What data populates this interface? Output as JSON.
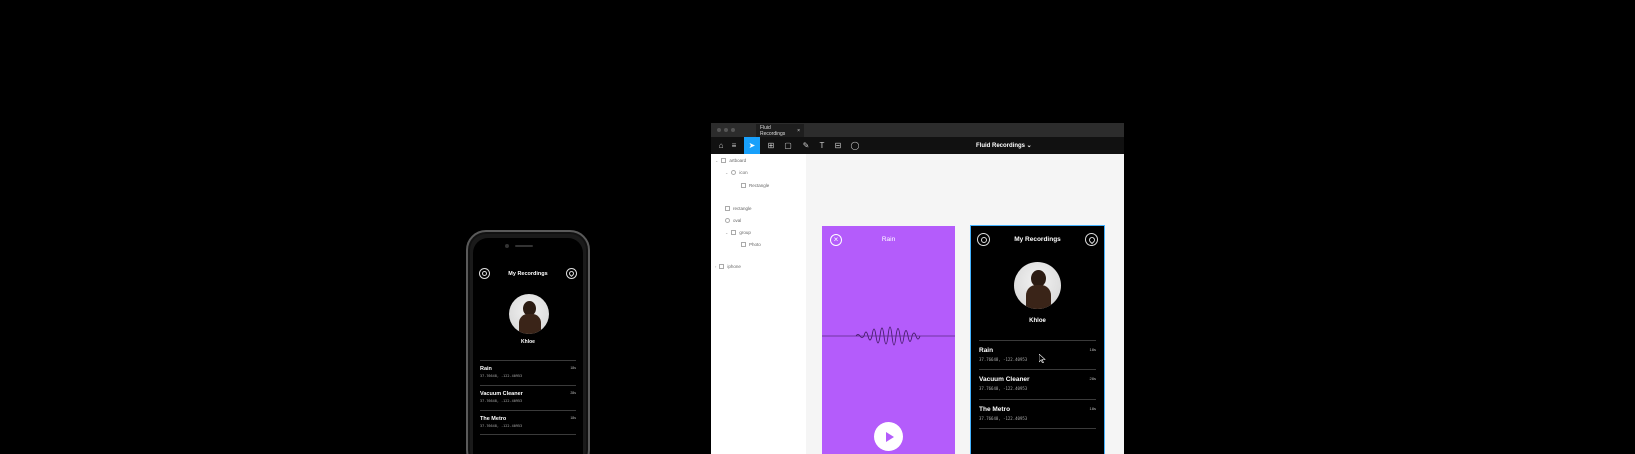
{
  "phone_app": {
    "title": "My Recordings",
    "user_name": "Khloe",
    "recordings": [
      {
        "title": "Rain",
        "duration": "18s",
        "coords": "37.76648, -122.40953"
      },
      {
        "title": "Vacuum Cleaner",
        "duration": "28s",
        "coords": "37.76648, -122.40953"
      },
      {
        "title": "The Metro",
        "duration": "18s",
        "coords": "37.76648, -122.40953"
      }
    ]
  },
  "figma": {
    "tab_label": "Fluid Recordings",
    "tab_close": "×",
    "file_name": "Fluid Recordings ⌄",
    "layers": [
      {
        "label": "artboard"
      },
      {
        "label": "icon"
      },
      {
        "label": "Rectangle"
      },
      {
        "label": "rectangle"
      },
      {
        "label": "oval"
      },
      {
        "label": "group"
      },
      {
        "label": "Photo"
      },
      {
        "label": "iphone"
      }
    ],
    "rain_frame": {
      "title": "Rain",
      "close": "×"
    },
    "recordings_frame": {
      "title": "My Recordings",
      "user_name": "Khloe",
      "recordings": [
        {
          "title": "Rain",
          "duration": "18s",
          "coords": "37.76648, -122.40953"
        },
        {
          "title": "Vacuum Cleaner",
          "duration": "28s",
          "coords": "37.76648, -122.40953"
        },
        {
          "title": "The Metro",
          "duration": "18s",
          "coords": "37.76648, -122.40953"
        }
      ]
    }
  },
  "icons": {
    "home": "⌂",
    "menu": "≡",
    "move": "➤",
    "frame": "⊞",
    "shape": "▢",
    "pen": "✎",
    "text": "T",
    "component": "⊟",
    "comment": "◯"
  },
  "colors": {
    "rain_purple": "#b45cfb",
    "selection_blue": "#45b3ff",
    "tool_active": "#18a0fb"
  }
}
